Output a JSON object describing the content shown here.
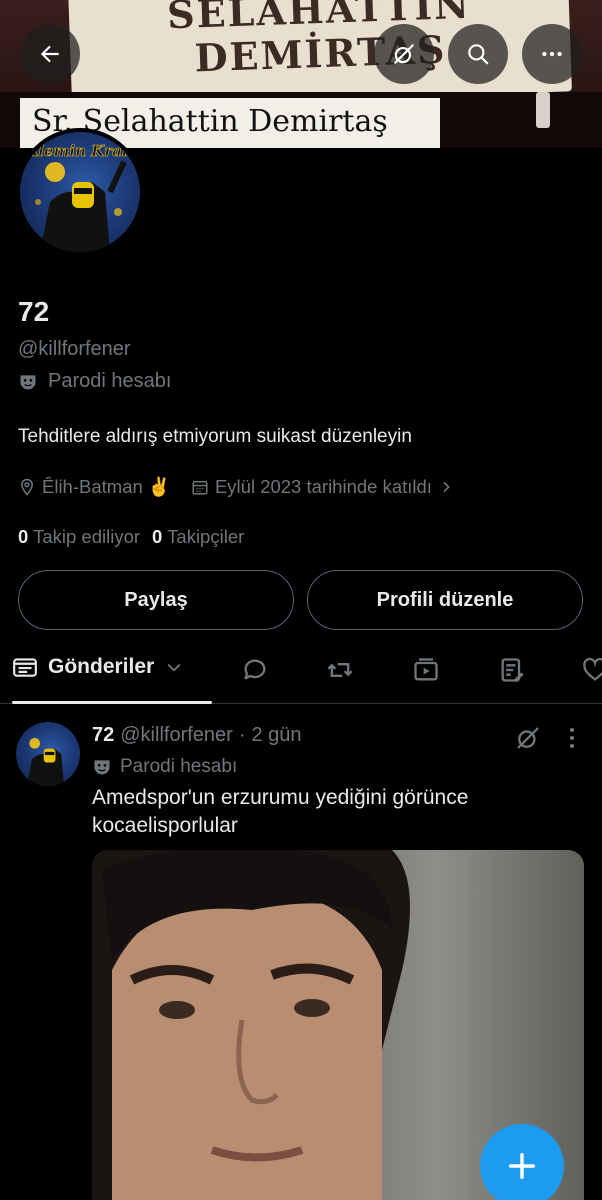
{
  "banner": {
    "sign_text_line1": "SELAHATTIN",
    "sign_text_line2": "DEMİRTAŞ",
    "caption": "Sr. Selahattin Demirtaş"
  },
  "header": {
    "back_icon": "arrow-left-icon",
    "grok_icon": "slashed-circle-icon",
    "search_icon": "search-icon",
    "more_icon": "more-horizontal-icon"
  },
  "avatar": {
    "label": "Âlemin Kralı"
  },
  "profile": {
    "name": "72",
    "handle": "@killforfener",
    "parody_label": "Parodi hesabı",
    "bio": "Tehditlere aldırış etmiyorum suikast düzenleyin",
    "location": "Êlih-Batman ✌️",
    "joined": "Eylül 2023 tarihinde katıldı",
    "following_count": "0",
    "following_label": "Takip ediliyor",
    "followers_count": "0",
    "followers_label": "Takipçiler"
  },
  "buttons": {
    "share": "Paylaş",
    "edit_profile": "Profili düzenle"
  },
  "tabs": {
    "active_label": "Gönderiler",
    "icons": [
      "reply-icon",
      "retweet-icon",
      "video-icon",
      "article-icon",
      "like-icon"
    ]
  },
  "post": {
    "name": "72",
    "handle": "@killforfener",
    "separator": "·",
    "time": "2 gün",
    "parody_label": "Parodi hesabı",
    "text": "Amedspor'un erzurumu yediğini görünce kocaelisporlular"
  },
  "colors": {
    "accent": "#1d9bf0",
    "background": "#000000",
    "muted_text": "#71767b",
    "primary_text": "#e7e9ea",
    "border": "#536471"
  }
}
